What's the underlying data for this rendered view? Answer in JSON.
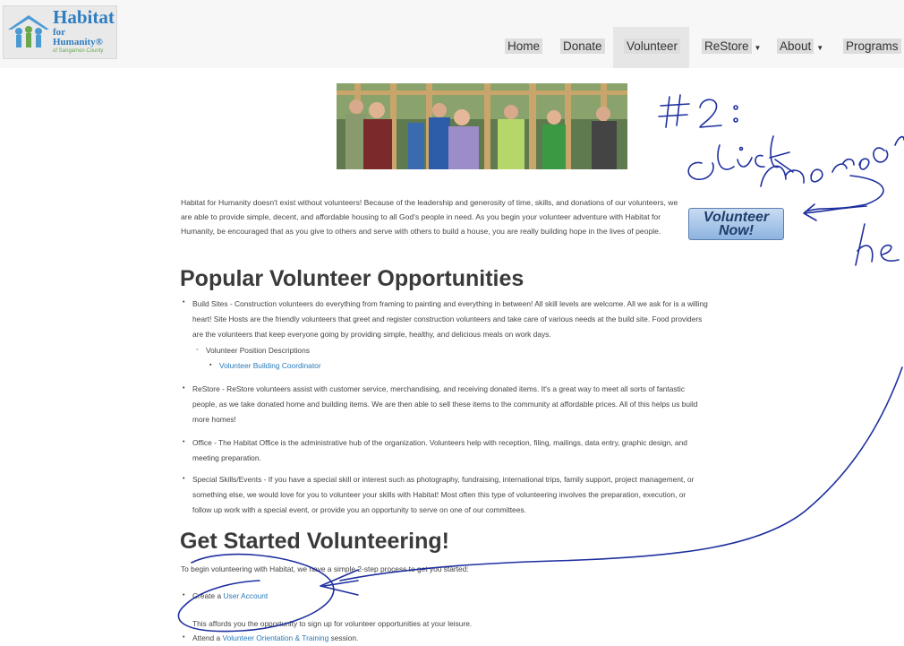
{
  "nav": {
    "logo": {
      "line1": "Habitat",
      "line2": "for Humanity®",
      "line3": "of Sangamon County"
    },
    "items": [
      {
        "label": "Home",
        "dropdown": false
      },
      {
        "label": "Donate",
        "dropdown": false
      },
      {
        "label": "Volunteer",
        "dropdown": false,
        "active": true
      },
      {
        "label": "ReStore",
        "dropdown": true
      },
      {
        "label": "About",
        "dropdown": true
      },
      {
        "label": "Programs",
        "dropdown": true
      }
    ]
  },
  "intro": {
    "text": "Habitat for Humanity doesn't exist without volunteers! Because of the leadership and generosity of time, skills, and donations of our volunteers, we are able to provide simple, decent, and affordable housing to all God's people in need. As you begin your volunteer adventure with Habitat for Humanity, be encouraged that as you give to others and serve with others to build a house, you are really building hope in the lives of people.",
    "button": {
      "line1": "Volunteer",
      "line2": "Now!"
    }
  },
  "popular": {
    "heading": "Popular Volunteer Opportunities",
    "items": [
      {
        "l1": "Build Sites - Construction volunteers do everything from framing to painting and everything in between! All skill levels are welcome. All we ask for is a willing",
        "l2": "heart! Site Hosts are the friendly volunteers that greet and register construction volunteers and take care of various needs at the build site. Food providers",
        "l3": "are the volunteers that keep everyone going by providing simple, healthy, and delicious meals on work days."
      },
      {
        "l1": "ReStore - ReStore volunteers assist with customer service, merchandising, and receiving donated items. It's a great way to meet all sorts of fantastic",
        "l2": "people, as we take donated home and building items. We are then able to sell these items to the community at affordable prices. All of this helps us build",
        "l3": "more homes!"
      },
      {
        "l1": "Office - The Habitat Office is the administrative hub of the organization. Volunteers help with reception, filing, mailings, data entry, graphic design, and",
        "l2": "meeting preparation."
      },
      {
        "l1": "Special Skills/Events - If you have a special skill or interest such as photography, fundraising, international trips, family support, project management, or",
        "l2": "something else, we would love for you to volunteer your skills with Habitat! Most often this type of volunteering involves the  preparation, execution, or",
        "l3": "follow up work with a special event, or provide you an opportunity to serve on one of our committees."
      }
    ],
    "sub_heading": "Volunteer Position Descriptions",
    "sub_link": "Volunteer Building Coordinator"
  },
  "start": {
    "heading": "Get Started Volunteering!",
    "intro": "To begin volunteering with Habitat, we have a simple 2-step process to get you started:",
    "step1_prefix": "Create a ",
    "step1_link": "User Account",
    "step1_note": "This affords you the opportunity to sign up for volunteer opportunities at your leisure.",
    "step2_prefix": "Attend a ",
    "step2_link": "Volunteer Orientation & Training",
    "step2_suffix": " session."
  },
  "annotation": {
    "label": "#2:",
    "text": "click here or",
    "fragment": "he",
    "color": "#1e2f9e"
  },
  "colors": {
    "link": "#2a7ab8",
    "ink": "#1e2f9e",
    "nav_bg": "#f7f7f7"
  }
}
